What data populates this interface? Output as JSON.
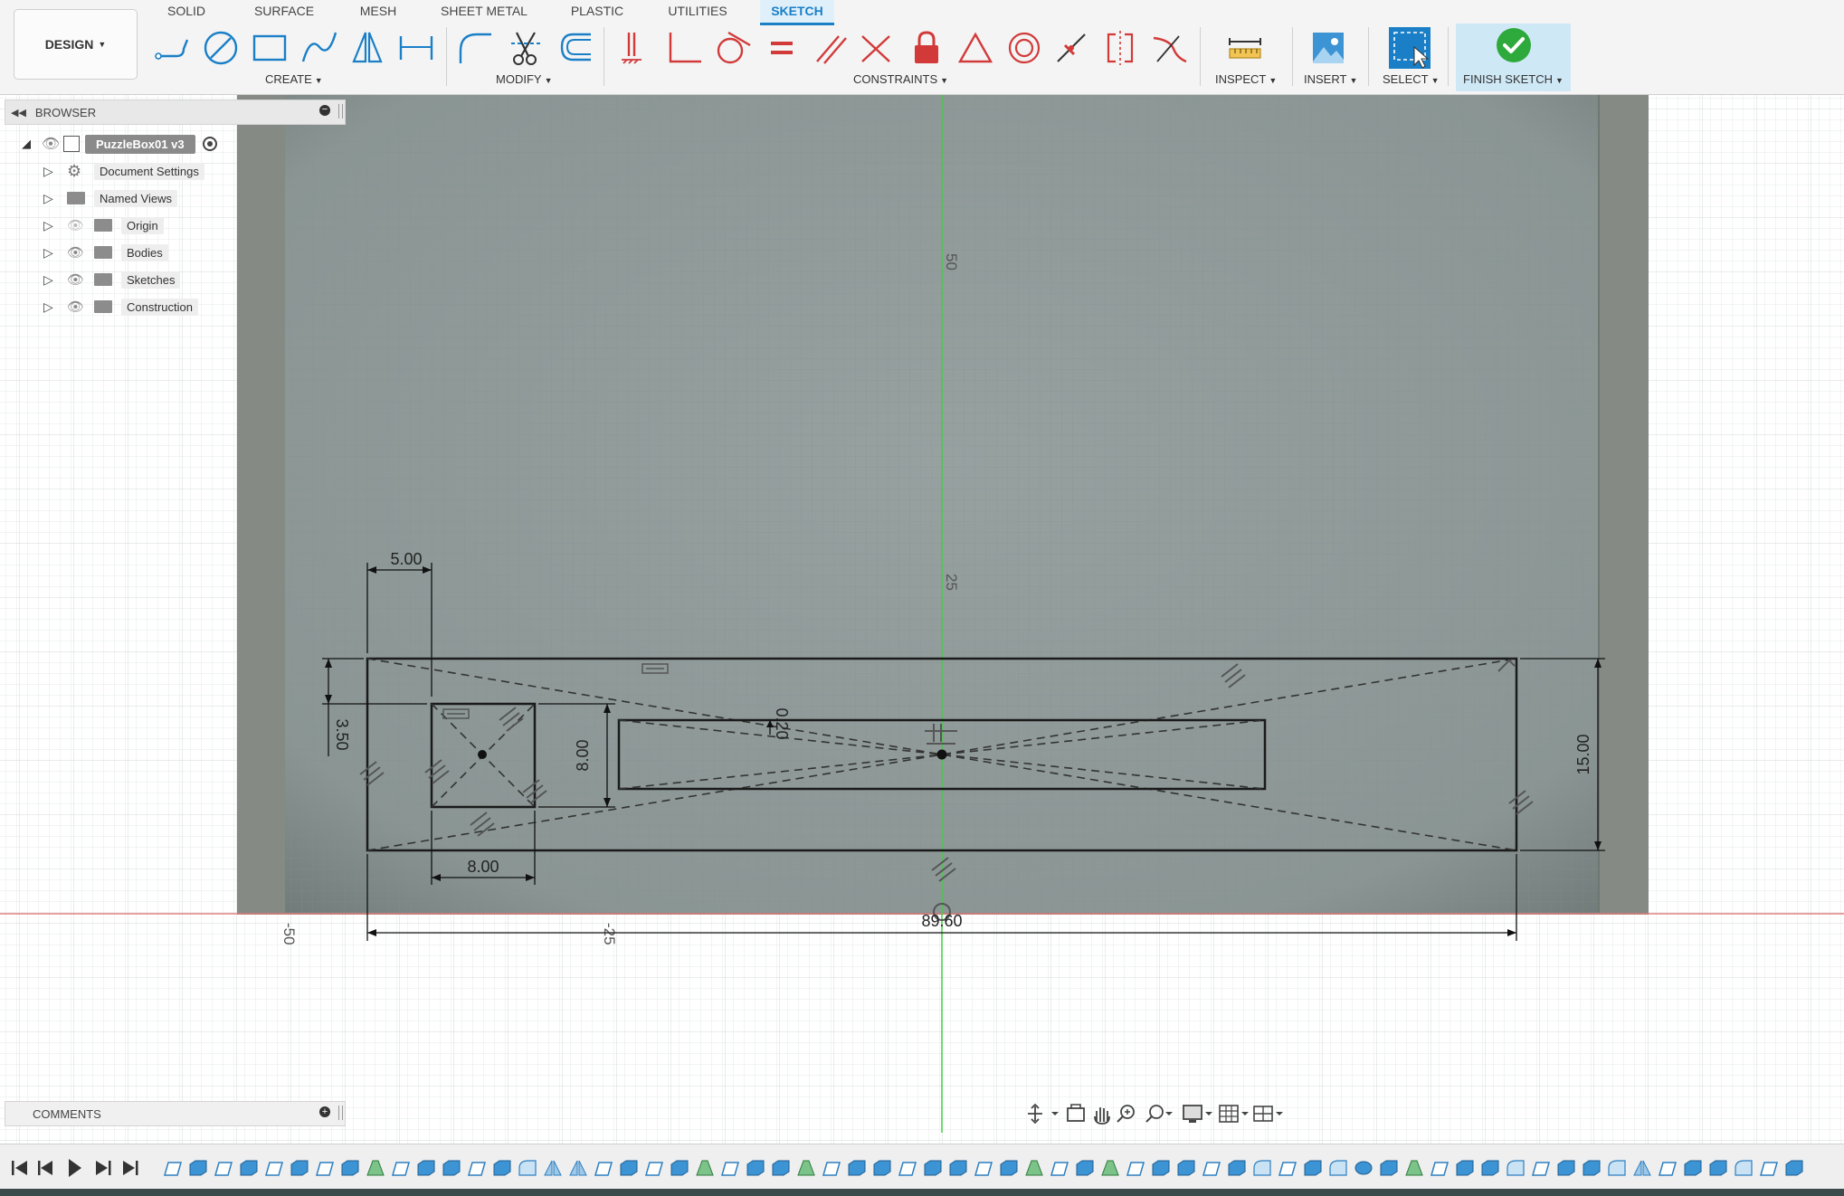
{
  "toolbar": {
    "workspace": "DESIGN",
    "tabs": [
      {
        "label": "SOLID"
      },
      {
        "label": "SURFACE"
      },
      {
        "label": "MESH"
      },
      {
        "label": "SHEET METAL"
      },
      {
        "label": "PLASTIC"
      },
      {
        "label": "UTILITIES"
      },
      {
        "label": "SKETCH",
        "active": true
      }
    ],
    "groups": {
      "create": "CREATE",
      "modify": "MODIFY",
      "constraints": "CONSTRAINTS",
      "inspect": "INSPECT",
      "insert": "INSERT",
      "select": "SELECT",
      "finish": "FINISH SKETCH"
    },
    "create_tools": [
      "line-icon",
      "circle-icon",
      "rectangle-icon",
      "spline-icon",
      "mirror-icon",
      "dimension-icon"
    ],
    "modify_tools": [
      "fillet-icon",
      "trim-icon",
      "offset-icon"
    ],
    "constraint_tools": [
      "fix-icon",
      "perpendicular-icon",
      "tangent-icon",
      "equal-icon",
      "parallel-icon",
      "coincident-icon",
      "lock-icon",
      "triangle-icon",
      "concentric-icon",
      "midpoint-icon",
      "symmetry-icon",
      "curvature-icon"
    ]
  },
  "browser": {
    "title": "BROWSER",
    "root": "PuzzleBox01 v3",
    "items": [
      {
        "label": "Document Settings",
        "icon": "gear-icon"
      },
      {
        "label": "Named Views",
        "icon": "folder-icon"
      },
      {
        "label": "Origin",
        "icon": "folder-icon",
        "hidden": true
      },
      {
        "label": "Bodies",
        "icon": "folder-icon"
      },
      {
        "label": "Sketches",
        "icon": "folder-icon"
      },
      {
        "label": "Construction",
        "icon": "folder-icon"
      }
    ]
  },
  "comments": {
    "title": "COMMENTS"
  },
  "sketch": {
    "dimensions": {
      "d_5": "5.00",
      "d_8_bottom": "8.00",
      "d_8_side": "8.00",
      "d_3_5": "3.50",
      "d_0_20": "0.20",
      "d_15": "15.00",
      "d_89_6": "89.60"
    },
    "axis_ticks": {
      "y_50": "50",
      "y_25": "25",
      "x_neg50": "-50",
      "x_neg25": "-25"
    }
  },
  "colors": {
    "accent": "#1a7fc7",
    "finish_green": "#2eaa3c",
    "constraint_red": "#d23a3a",
    "canvas_gray": "#8e9898"
  }
}
